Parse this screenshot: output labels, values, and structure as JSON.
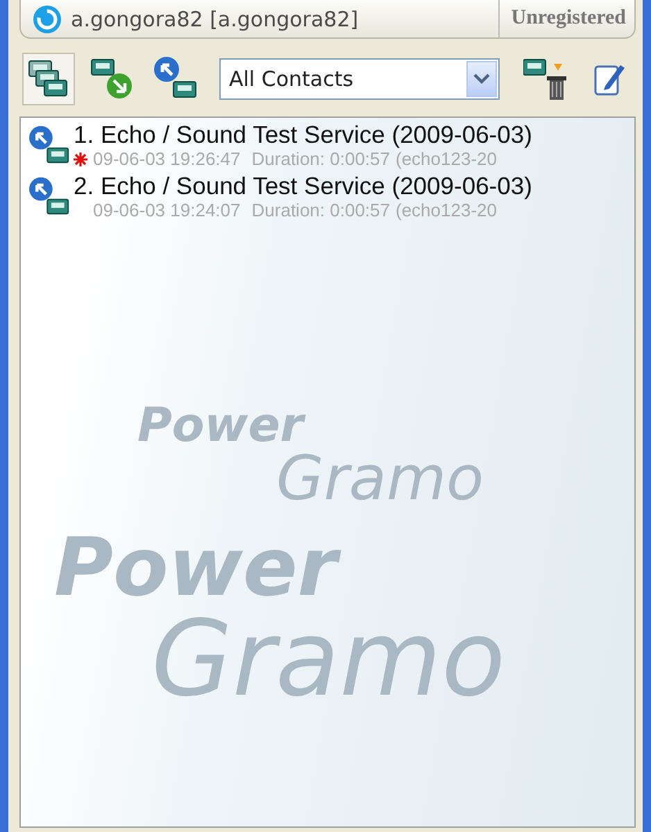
{
  "account": {
    "name": "a.gongora82 [a.gongora82]",
    "status": "Unregistered"
  },
  "toolbar": {
    "buttons": [
      {
        "kind": "recordings",
        "selected": true
      },
      {
        "kind": "import",
        "selected": false
      },
      {
        "kind": "call",
        "selected": false
      }
    ],
    "filter": {
      "value": "All Contacts"
    },
    "actions": [
      {
        "kind": "delete"
      },
      {
        "kind": "edit"
      }
    ]
  },
  "recordings": [
    {
      "title": "1. Echo / Sound Test Service (2009-06-03)",
      "date": "09-06-03 19:26:47",
      "duration": "Duration: 0:00:57",
      "source": "(echo123-20",
      "new": true
    },
    {
      "title": "2. Echo / Sound Test Service (2009-06-03)",
      "date": "09-06-03 19:24:07",
      "duration": "Duration: 0:00:57",
      "source": "(echo123-20",
      "new": false
    }
  ],
  "background_logo": {
    "small": [
      "Power",
      "Gramo"
    ],
    "large": [
      "Power",
      "Gramo"
    ]
  }
}
